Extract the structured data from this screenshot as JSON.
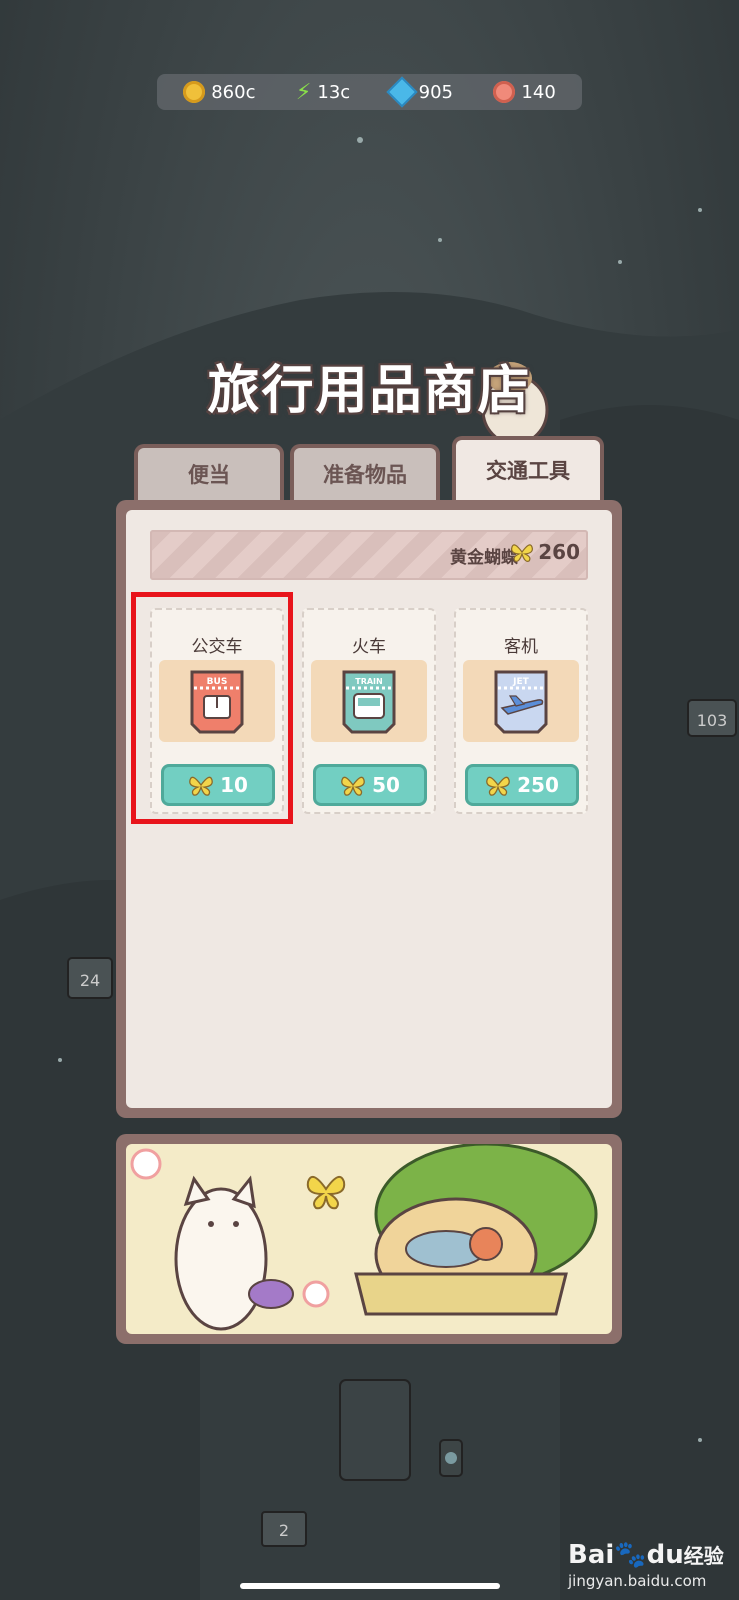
{
  "currencies": [
    {
      "name": "coin",
      "value": "860c",
      "icon": "coin-icon",
      "color": "#f0c03a"
    },
    {
      "name": "energy",
      "value": "13c",
      "icon": "lightning-icon",
      "color": "#8ae04a"
    },
    {
      "name": "gem",
      "value": "905",
      "icon": "gem-icon",
      "color": "#4ab8e8"
    },
    {
      "name": "shell",
      "value": "140",
      "icon": "shell-icon",
      "color": "#f08a7a"
    }
  ],
  "shop": {
    "title": "旅行用品商店",
    "tabs": [
      {
        "label": "便当",
        "active": false
      },
      {
        "label": "准备物品",
        "active": false
      },
      {
        "label": "交通工具",
        "active": true
      }
    ],
    "banner": {
      "label": "黄金蝴蝶",
      "count": "260",
      "icon": "butterfly-icon"
    },
    "items": [
      {
        "name": "公交车",
        "badge": "BUS",
        "price": "10",
        "icon": "bus-icon",
        "highlighted": true
      },
      {
        "name": "火车",
        "badge": "TRAIN",
        "price": "50",
        "icon": "train-icon",
        "highlighted": false
      },
      {
        "name": "客机",
        "badge": "JET",
        "price": "250",
        "icon": "jet-icon",
        "highlighted": false
      }
    ]
  },
  "watermark": {
    "brand": "Bai",
    "brand2": "du",
    "brand3": "经验",
    "url": "jingyan.baidu.com"
  },
  "colors": {
    "accent_teal": "#72cfc2",
    "highlight_red": "#e8141b",
    "panel_brown": "#8c6f6b"
  }
}
